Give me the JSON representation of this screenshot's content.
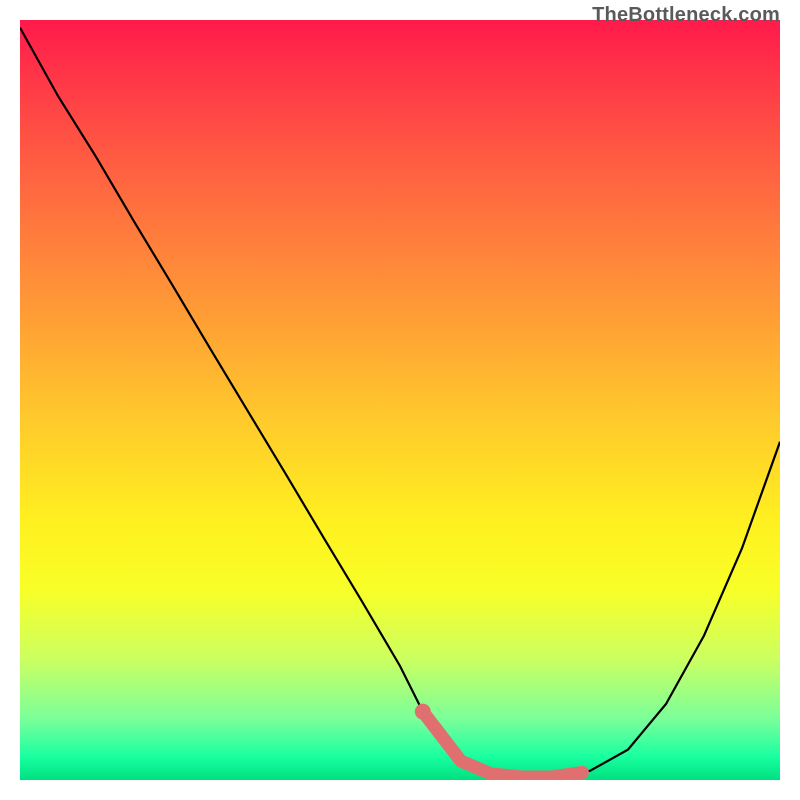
{
  "watermark": "TheBottleneck.com",
  "colors": {
    "gradient_top": "#ff1a4a",
    "gradient_bottom": "#00e080",
    "curve": "#000000",
    "highlight": "#e07070",
    "background": "#ffffff"
  },
  "chart_data": {
    "type": "line",
    "title": "",
    "xlabel": "",
    "ylabel": "",
    "xlim": [
      0,
      100
    ],
    "ylim": [
      0,
      100
    ],
    "series": [
      {
        "name": "curve",
        "x": [
          0,
          5,
          10,
          15,
          20,
          25,
          30,
          35,
          40,
          45,
          50,
          53,
          56,
          58,
          60,
          63,
          66,
          70,
          75,
          80,
          85,
          90,
          95,
          100
        ],
        "values": [
          99,
          90.0,
          82.0,
          73.5,
          65.2,
          56.8,
          48.5,
          40.2,
          31.8,
          23.5,
          15.0,
          9.0,
          4.5,
          2.5,
          1.2,
          0.6,
          0.4,
          0.4,
          1.2,
          4.0,
          10.0,
          19.0,
          30.5,
          44.5
        ]
      }
    ],
    "highlight": {
      "name": "optimal-range",
      "x": [
        53,
        58,
        62,
        66,
        70,
        74
      ],
      "values": [
        9.0,
        2.5,
        0.8,
        0.4,
        0.4,
        1.0
      ]
    },
    "highlight_dot": {
      "x": 53,
      "value": 9.0
    }
  }
}
